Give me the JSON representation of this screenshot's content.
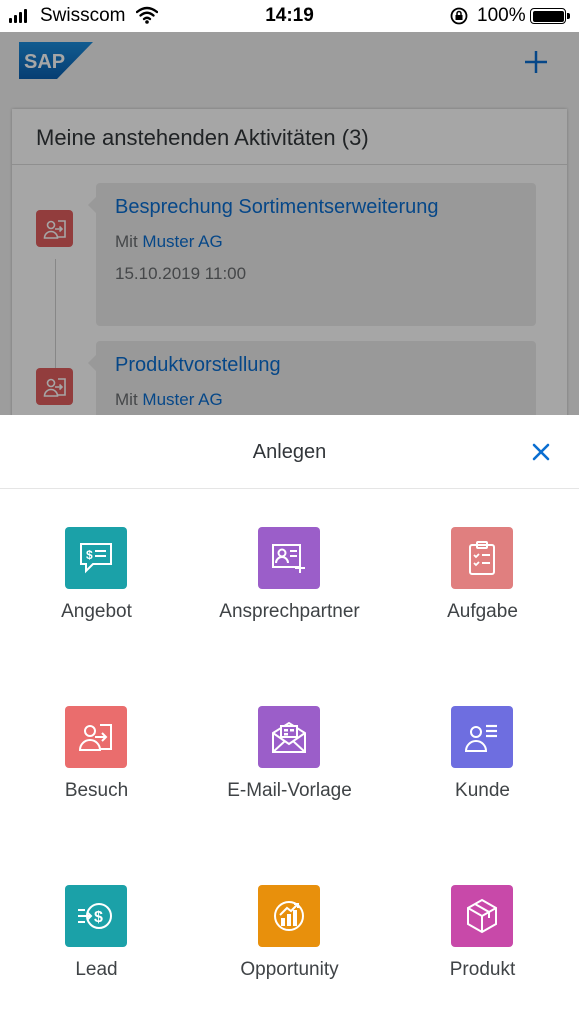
{
  "status_bar": {
    "carrier": "Swisscom",
    "time": "14:19",
    "battery": "100%"
  },
  "header": {
    "logo_text": "SAP",
    "add_icon": "plus-icon"
  },
  "activities": {
    "title": "Meine anstehenden Aktivitäten (3)",
    "items": [
      {
        "title": "Besprechung Sortimentserweiterung",
        "prefix": "Mit",
        "company": "Muster AG",
        "date": "15.10.2019 11:00",
        "icon": "visit-icon"
      },
      {
        "title": "Produktvorstellung",
        "prefix": "Mit",
        "company": "Muster AG",
        "icon": "visit-icon"
      }
    ]
  },
  "sheet": {
    "title": "Anlegen",
    "close_icon": "close-icon",
    "items": [
      {
        "label": "Angebot",
        "icon": "quote-icon",
        "color": "#1ba1a8"
      },
      {
        "label": "Ansprechpartner",
        "icon": "contact-add-icon",
        "color": "#9b5ec9"
      },
      {
        "label": "Aufgabe",
        "icon": "task-clipboard-icon",
        "color": "#e07f7f"
      },
      {
        "label": "Besuch",
        "icon": "visit-icon",
        "color": "#ea6d6d"
      },
      {
        "label": "E-Mail-Vorlage",
        "icon": "email-template-icon",
        "color": "#9b5ec9"
      },
      {
        "label": "Kunde",
        "icon": "customer-icon",
        "color": "#6e6ee0"
      },
      {
        "label": "Lead",
        "icon": "lead-icon",
        "color": "#1ba1a8"
      },
      {
        "label": "Opportunity",
        "icon": "opportunity-icon",
        "color": "#e8900c"
      },
      {
        "label": "Produkt",
        "icon": "product-icon",
        "color": "#c849a9"
      }
    ]
  },
  "colors": {
    "accent": "#0a6ed1",
    "visit_red": "#e05f5f"
  }
}
